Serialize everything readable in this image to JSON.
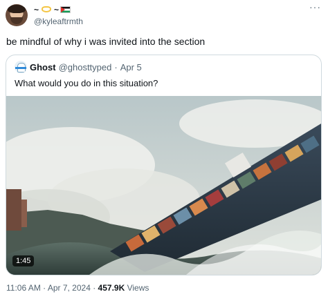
{
  "author": {
    "display_name_prefix": "~",
    "display_name_suffix": "~",
    "handle": "@kyleaftrmth",
    "more_label": "···"
  },
  "tweet": {
    "text": "be mindful of why i was invited into the section",
    "time": "11:06 AM",
    "sep1": " · ",
    "date": "Apr 7, 2024",
    "sep2": " · ",
    "views": "457.9K",
    "views_label": " Views"
  },
  "quoted": {
    "name": "Ghost",
    "handle": "@ghosttyped",
    "sep": "·",
    "date": "Apr 5",
    "text": "What would you do in this situation?",
    "video_duration": "1:45"
  },
  "icons": [
    "avatar",
    "heart-emoji",
    "flag-icon",
    "more-icon",
    "quoted-avatar"
  ],
  "colors": {
    "text": "#0f1419",
    "muted": "#536471",
    "border": "#cfd9de"
  }
}
